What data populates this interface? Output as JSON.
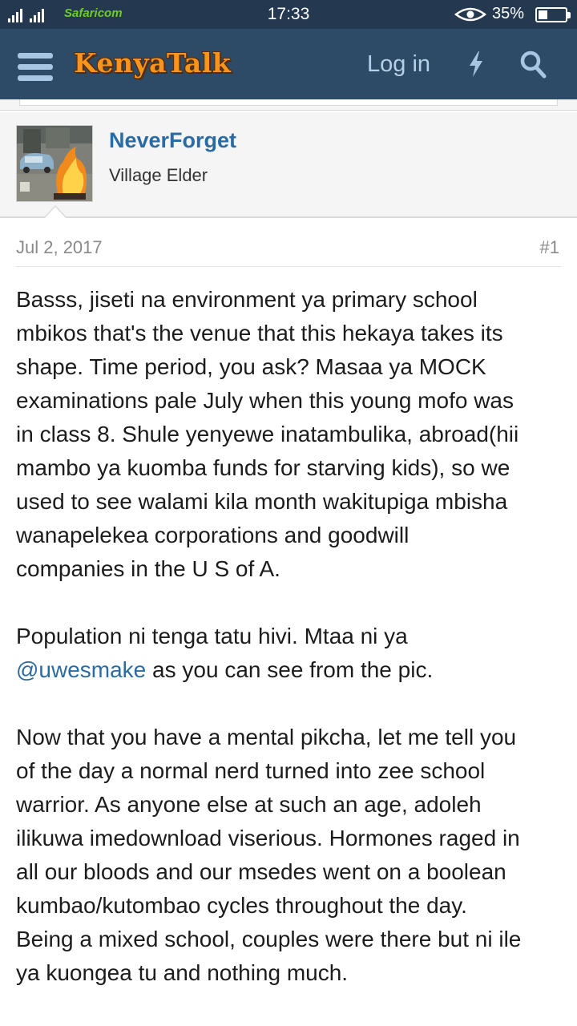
{
  "status_bar": {
    "carrier": "Safaricom",
    "time": "17:33",
    "battery": "35%",
    "battery_level": 0.35
  },
  "header": {
    "logo": "KenyaTalk",
    "login": "Log in"
  },
  "author": {
    "name": "NeverForget",
    "title": "Village Elder"
  },
  "post": {
    "date": "Jul 2, 2017",
    "number": "#1",
    "p1": [
      "Basss, jiseti na environment ya primary school",
      "mbikos that's the venue that this hekaya takes its",
      "shape. Time period, you ask? Masaa ya MOCK",
      "examinations pale July when this young mofo was",
      "in class 8. Shule yenyewe inatambulika, abroad(hii",
      "mambo ya kuomba funds for starving kids), so we",
      "used to see walami kila month wakitupiga mbisha",
      "wanapelekea corporations and goodwill",
      "companies in the U S of A."
    ],
    "p2_line1": "Population ni tenga tatu hivi. Mtaa ni ya",
    "p2_mention": "@uwesmake",
    "p2_rest": " as you can see from the pic.",
    "p3": [
      "Now that you have a mental pikcha, let me tell you",
      "of the day a normal nerd turned into zee school",
      "warrior. As anyone else at such an age, adoleh",
      "ilikuwa imedownload viserious. Hormones raged in",
      "all our bloods and our msedes went on a boolean",
      "kumbao/kutombao cycles throughout the day.",
      "Being a mixed school, couples were there but ni ile",
      "ya kuongea tu and nothing much."
    ]
  },
  "colors": {
    "header_bg": "#2d4a66",
    "status_bg": "#24394f",
    "link": "#2b6ba3",
    "logo": "#f7941d"
  },
  "icons": [
    "menu-icon",
    "bolt-icon",
    "search-icon",
    "eye-icon",
    "battery-icon",
    "signal-icon"
  ]
}
